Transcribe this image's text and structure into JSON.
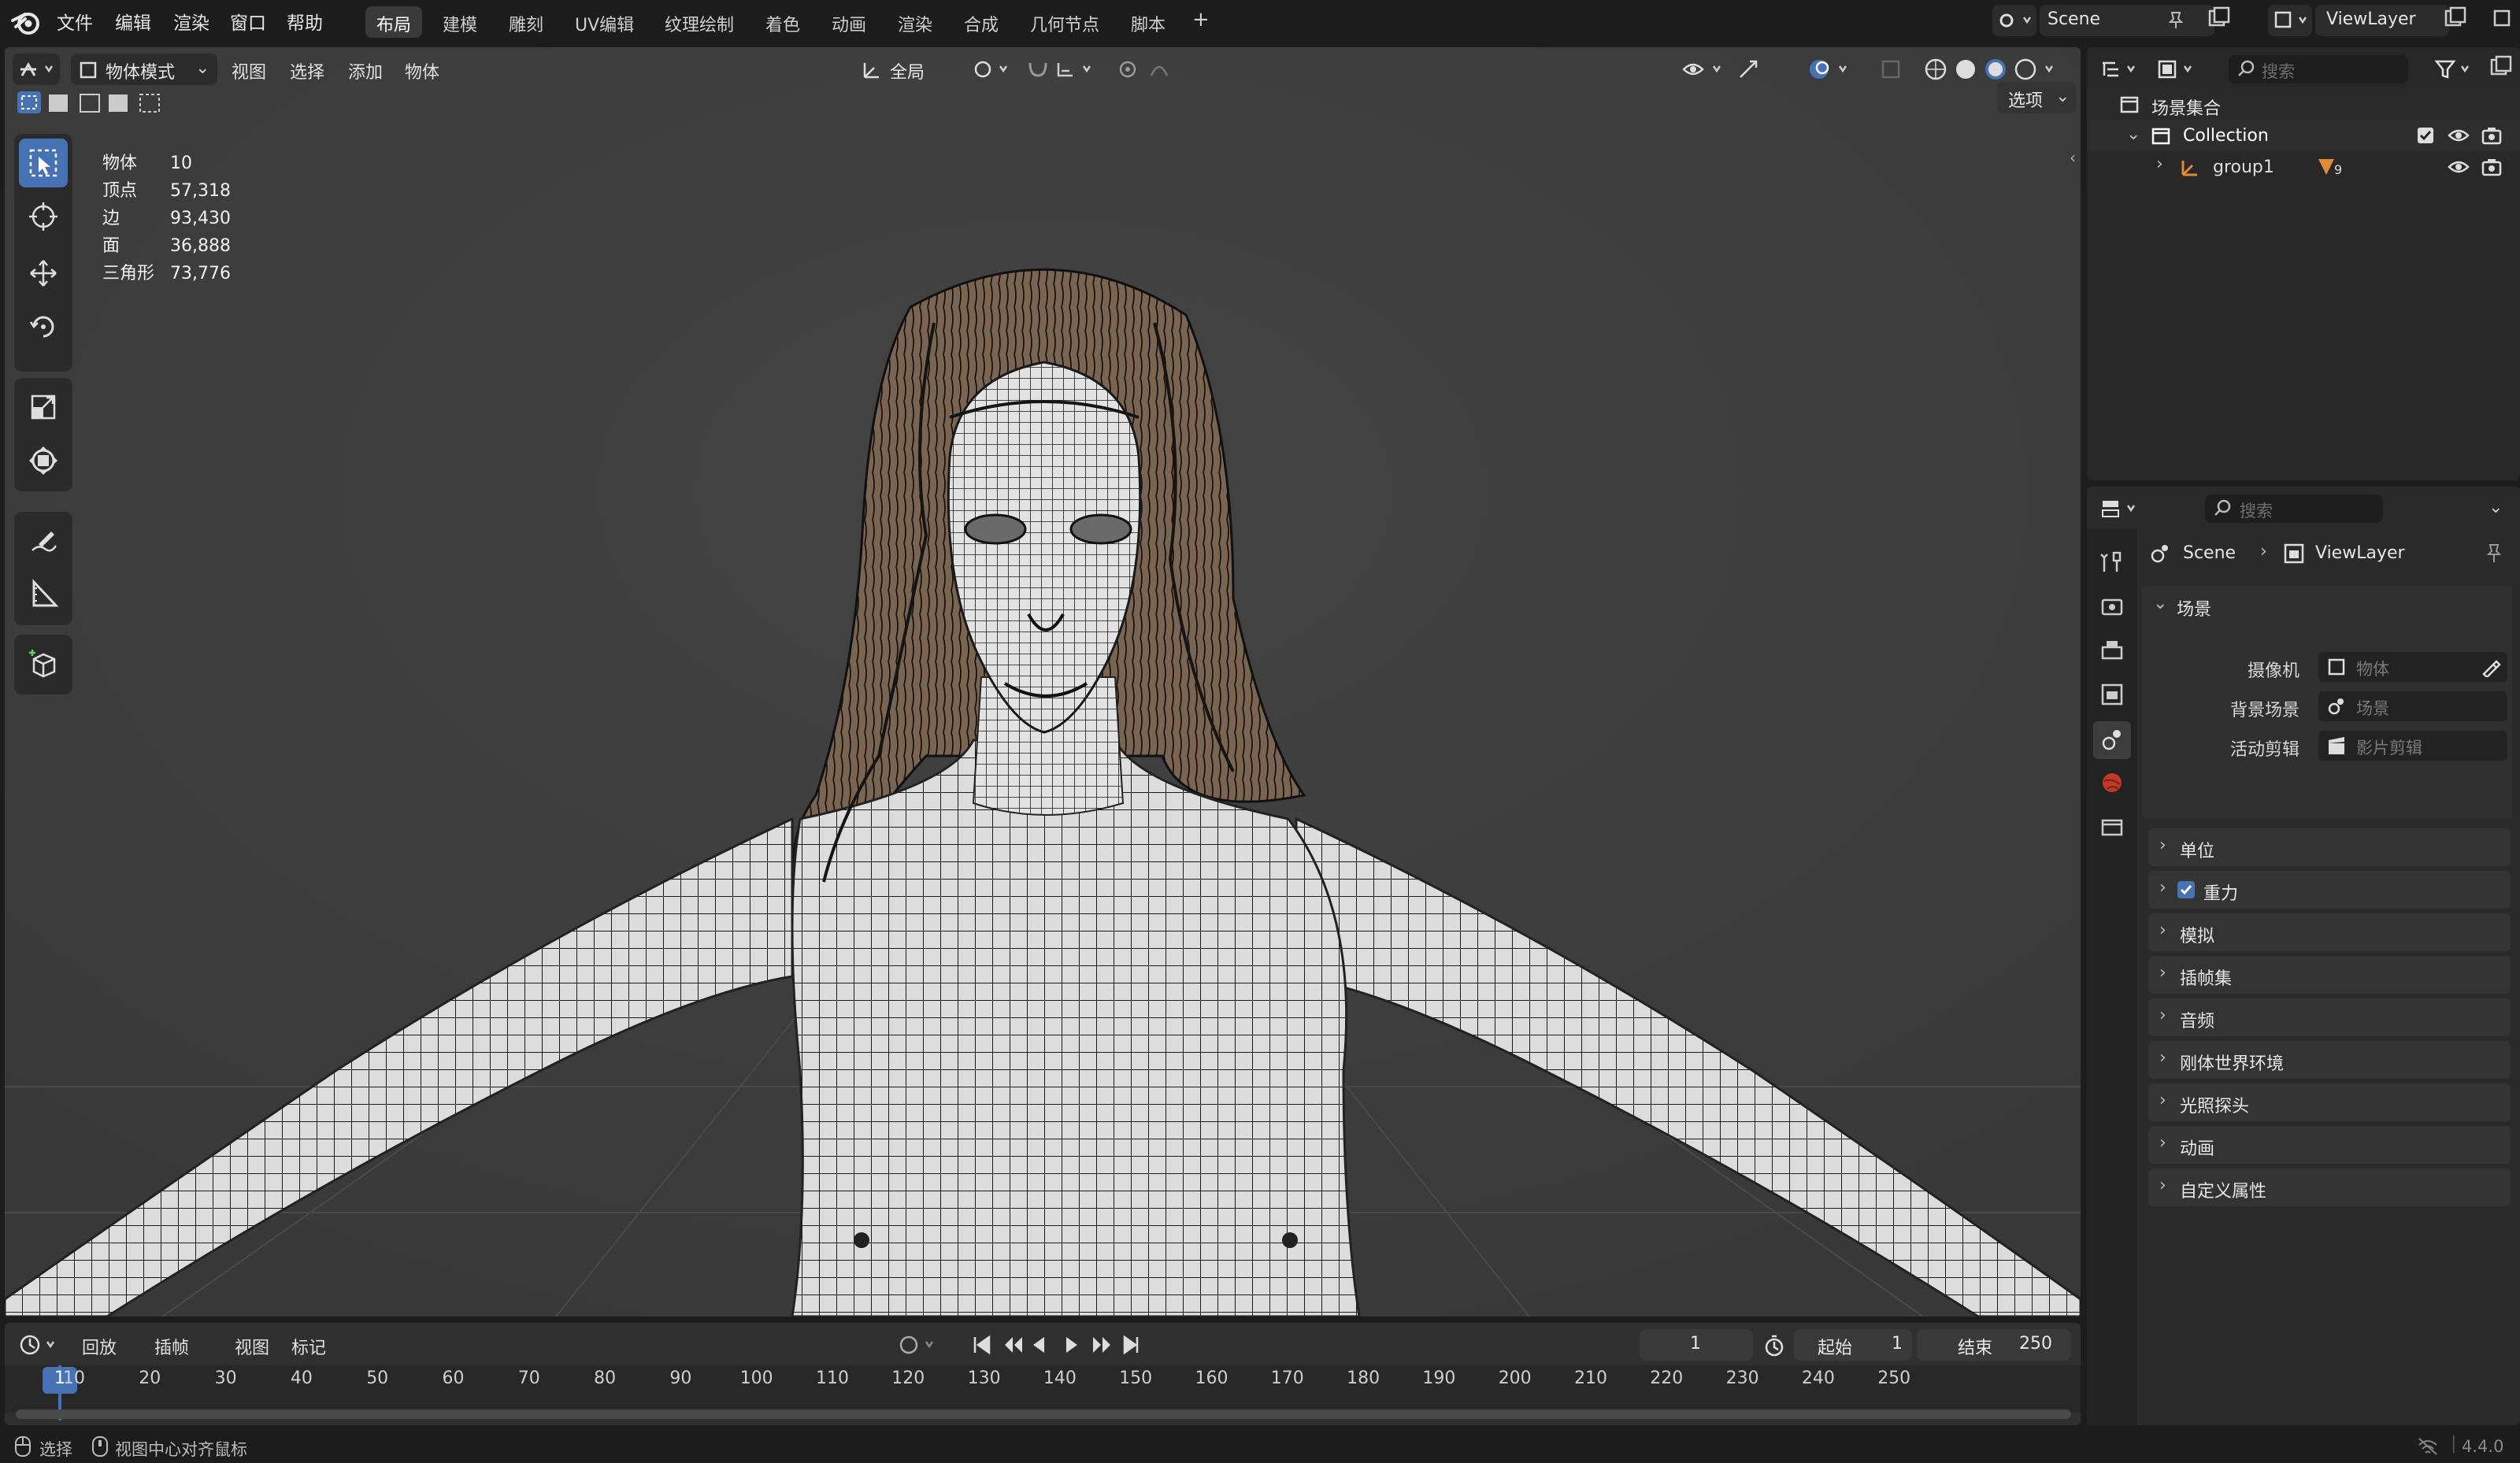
{
  "menu": {
    "items": [
      "文件",
      "编辑",
      "渲染",
      "窗口",
      "帮助"
    ],
    "workspaces": [
      "布局",
      "建模",
      "雕刻",
      "UV编辑",
      "纹理绘制",
      "着色",
      "动画",
      "渲染",
      "合成",
      "几何节点",
      "脚本"
    ],
    "active_workspace": "布局",
    "add_tab": "+",
    "scene": "Scene",
    "view_layer": "ViewLayer"
  },
  "viewport": {
    "mode": "物体模式",
    "menus": [
      "视图",
      "选择",
      "添加",
      "物体"
    ],
    "transform_orientation": "全局",
    "options_label": "选项",
    "stats": [
      {
        "label": "物体",
        "value": "10"
      },
      {
        "label": "顶点",
        "value": "57,318"
      },
      {
        "label": "边",
        "value": "93,430"
      },
      {
        "label": "面",
        "value": "36,888"
      },
      {
        "label": "三角形",
        "value": "73,776"
      }
    ]
  },
  "timeline": {
    "menus": [
      "回放",
      "插帧",
      "视图",
      "标记"
    ],
    "current_frame": "1",
    "start_label": "起始",
    "start_value": "1",
    "end_label": "结束",
    "end_value": "250",
    "ticks": [
      "1",
      "10",
      "20",
      "30",
      "40",
      "50",
      "60",
      "70",
      "80",
      "90",
      "100",
      "110",
      "120",
      "130",
      "140",
      "150",
      "160",
      "170",
      "180",
      "190",
      "200",
      "210",
      "220",
      "230",
      "240",
      "250"
    ]
  },
  "outliner": {
    "search_placeholder": "搜索",
    "root": "场景集合",
    "collection": "Collection",
    "child": "group1",
    "child_badge": "9"
  },
  "properties": {
    "search_placeholder": "搜索",
    "breadcrumb_scene": "Scene",
    "breadcrumb_layer": "ViewLayer",
    "section_title": "场景",
    "fields": [
      {
        "label": "摄像机",
        "placeholder": "物体"
      },
      {
        "label": "背景场景",
        "placeholder": "场景"
      },
      {
        "label": "活动剪辑",
        "placeholder": "影片剪辑"
      }
    ],
    "panels": [
      "单位",
      "重力",
      "模拟",
      "插帧集",
      "音频",
      "刚体世界环境",
      "光照探头",
      "动画",
      "自定义属性"
    ]
  },
  "statusbar": {
    "select": "选择",
    "center": "视图中心对齐鼠标",
    "version": "4.4.0"
  },
  "colors": {
    "accent": "#4772b3",
    "bg": "#3d3d3d"
  }
}
